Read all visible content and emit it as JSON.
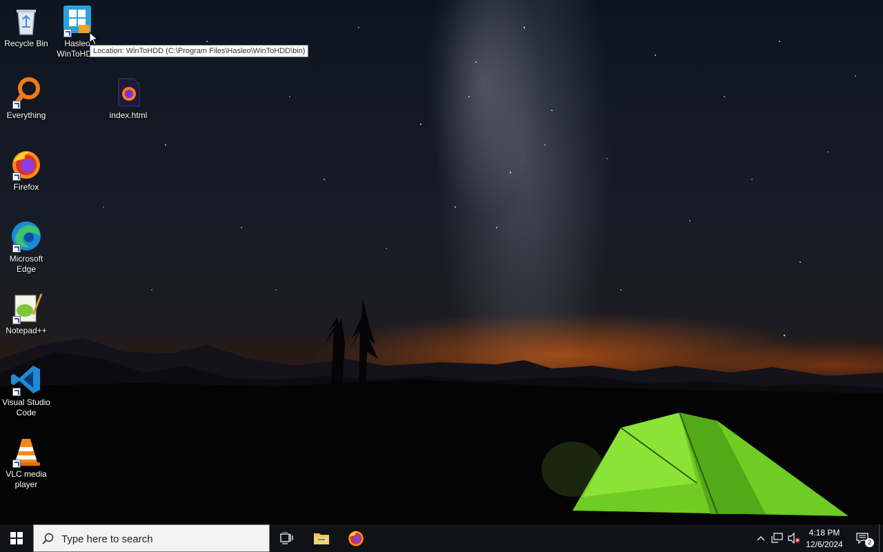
{
  "desktop": {
    "icons": [
      {
        "label": "Recycle Bin"
      },
      {
        "label": "Hasleo WinToHDD"
      },
      {
        "label": "Everything"
      },
      {
        "label": "index.html"
      },
      {
        "label": "Firefox"
      },
      {
        "label": "Microsoft Edge"
      },
      {
        "label": "Notepad++"
      },
      {
        "label": "Visual Studio Code"
      },
      {
        "label": "VLC media player"
      }
    ],
    "tooltip": "Location: WinToHDD (C:\\Program Files\\Hasleo\\WinToHDD\\bin)"
  },
  "taskbar": {
    "search_placeholder": "Type here to search",
    "pinned": [
      "task-view-icon",
      "file-explorer-icon",
      "firefox-icon"
    ],
    "tray": {
      "time": "4:18 PM",
      "date": "12/6/2024",
      "notification_count": "2"
    }
  }
}
